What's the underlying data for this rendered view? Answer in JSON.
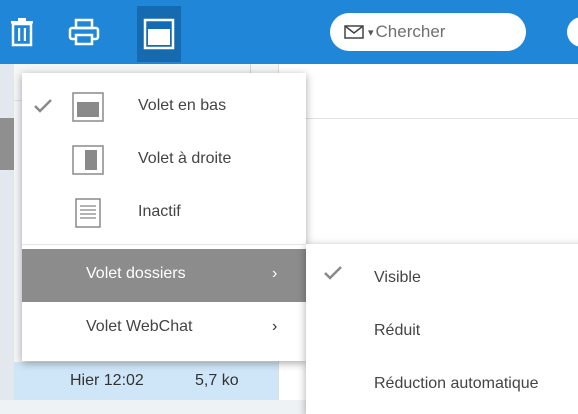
{
  "toolbar": {
    "search_placeholder": "Chercher",
    "search_caret": "▾"
  },
  "menu": {
    "items": [
      {
        "label": "Volet en bas",
        "checked": true,
        "icon": "pane-bottom-icon"
      },
      {
        "label": "Volet à droite",
        "checked": false,
        "icon": "pane-right-icon"
      },
      {
        "label": "Inactif",
        "checked": false,
        "icon": "pane-off-icon"
      }
    ],
    "submenus": [
      {
        "label": "Volet dossiers",
        "chevron": "›",
        "highlighted": true
      },
      {
        "label": "Volet WebChat",
        "chevron": "›",
        "highlighted": false
      }
    ]
  },
  "submenu": {
    "items": [
      {
        "label": "Visible",
        "checked": true
      },
      {
        "label": "Réduit",
        "checked": false
      },
      {
        "label": "Réduction automatique",
        "checked": false
      }
    ]
  },
  "list": {
    "row": {
      "date": "Hier 12:02",
      "size": "5,7 ko"
    }
  },
  "colors": {
    "toolbar": "#1f86d8",
    "highlight": "#8c8c8c",
    "selected_row": "#cfe6f8"
  }
}
